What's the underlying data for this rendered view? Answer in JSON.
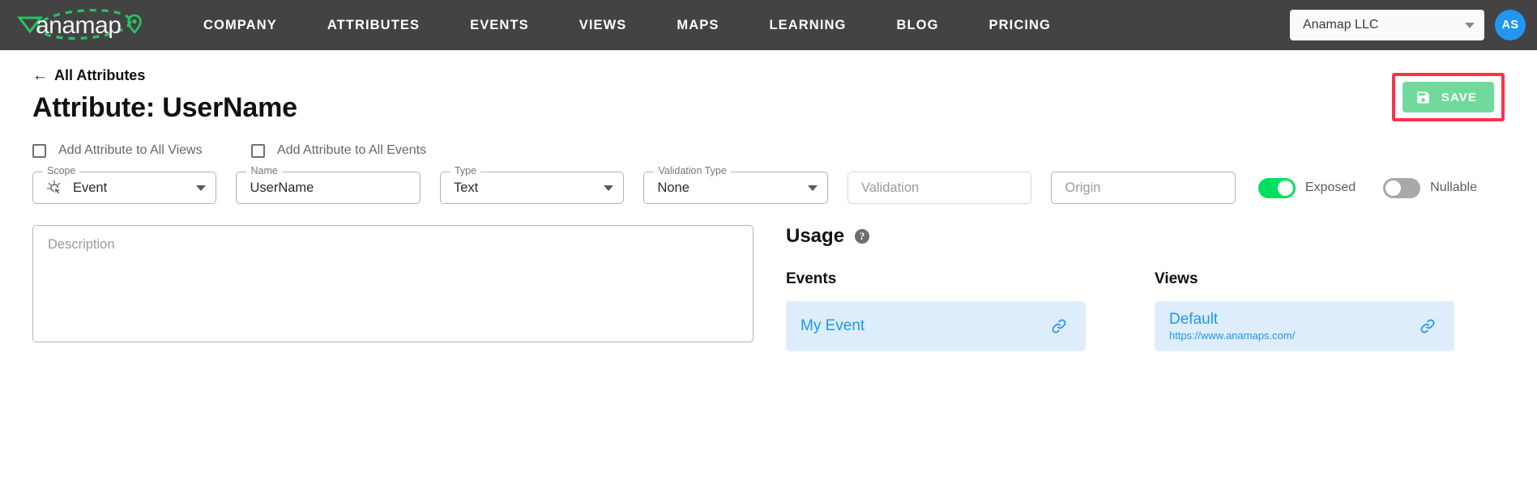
{
  "nav": {
    "logo_text": "anamap",
    "logo_icon": "location-pin-icon",
    "links": [
      {
        "label": "COMPANY"
      },
      {
        "label": "ATTRIBUTES"
      },
      {
        "label": "EVENTS"
      },
      {
        "label": "VIEWS"
      },
      {
        "label": "MAPS"
      },
      {
        "label": "LEARNING"
      },
      {
        "label": "BLOG"
      },
      {
        "label": "PRICING"
      }
    ],
    "org_selected": "Anamap LLC",
    "avatar_initials": "AS",
    "avatar_color": "#2196f3",
    "bar_color": "#434343"
  },
  "header": {
    "breadcrumb_arrow": "←",
    "breadcrumb_label": "All Attributes",
    "title": "Attribute: UserName",
    "save_label": "SAVE",
    "save_icon": "floppy-disk-save-icon",
    "save_color": "#70da9d",
    "highlight_color": "#f8344a"
  },
  "checkboxes": [
    {
      "label": "Add Attribute to All Views",
      "checked": false
    },
    {
      "label": "Add Attribute to All Events",
      "checked": false
    }
  ],
  "fields": {
    "scope": {
      "label": "Scope",
      "value": "Event",
      "icon": "ads-click-cursor-icon"
    },
    "name": {
      "label": "Name",
      "value": "UserName"
    },
    "type": {
      "label": "Type",
      "value": "Text"
    },
    "validation_type": {
      "label": "Validation Type",
      "value": "None"
    },
    "validation": {
      "placeholder": "Validation",
      "value": ""
    },
    "origin": {
      "placeholder": "Origin",
      "value": ""
    }
  },
  "toggles": [
    {
      "label": "Exposed",
      "state": "on",
      "color": "#00e05f"
    },
    {
      "label": "Nullable",
      "state": "off",
      "color": "#a8a8a8"
    }
  ],
  "description": {
    "placeholder": "Description",
    "value": ""
  },
  "usage": {
    "title": "Usage",
    "help_icon": "question-mark-help-icon",
    "events": {
      "heading": "Events",
      "cards": [
        {
          "primary": "My Event",
          "secondary": "",
          "icon": "link-chain-icon"
        }
      ]
    },
    "views": {
      "heading": "Views",
      "cards": [
        {
          "primary": "Default",
          "secondary": "https://www.anamaps.com/",
          "icon": "link-chain-icon"
        }
      ]
    }
  }
}
